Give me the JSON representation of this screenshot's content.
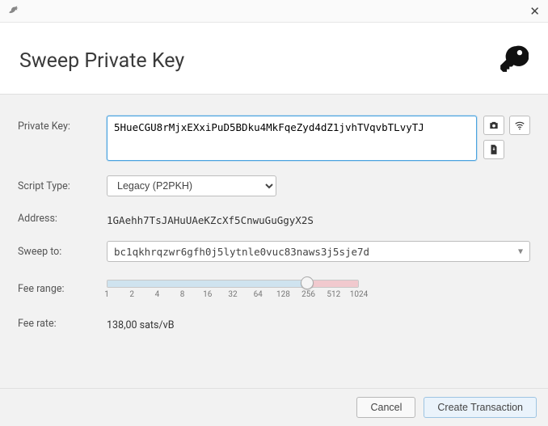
{
  "titlebar": {},
  "header": {
    "title": "Sweep Private Key"
  },
  "labels": {
    "private_key": "Private Key:",
    "script_type": "Script Type:",
    "address": "Address:",
    "sweep_to": "Sweep to:",
    "fee_range": "Fee range:",
    "fee_rate": "Fee rate:"
  },
  "private_key": {
    "value": "5HueCGU8rMjxEXxiPuD5BDku4MkFqeZyd4dZ1jvhTVqvbTLvyTJ"
  },
  "script_type": {
    "selected": "Legacy (P2PKH)"
  },
  "address": "1GAehh7TsJAHuUAeKZcXf5CnwuGuGgyX2S",
  "sweep_to": {
    "selected": "bc1qkhrqzwr6gfh0j5lytnle0vuc83naws3j5sje7d"
  },
  "fee_slider": {
    "ticks": [
      "1",
      "2",
      "4",
      "8",
      "16",
      "32",
      "64",
      "128",
      "256",
      "512",
      "1024"
    ]
  },
  "fee_rate": "138,00 sats/vB",
  "buttons": {
    "cancel": "Cancel",
    "create": "Create Transaction"
  }
}
